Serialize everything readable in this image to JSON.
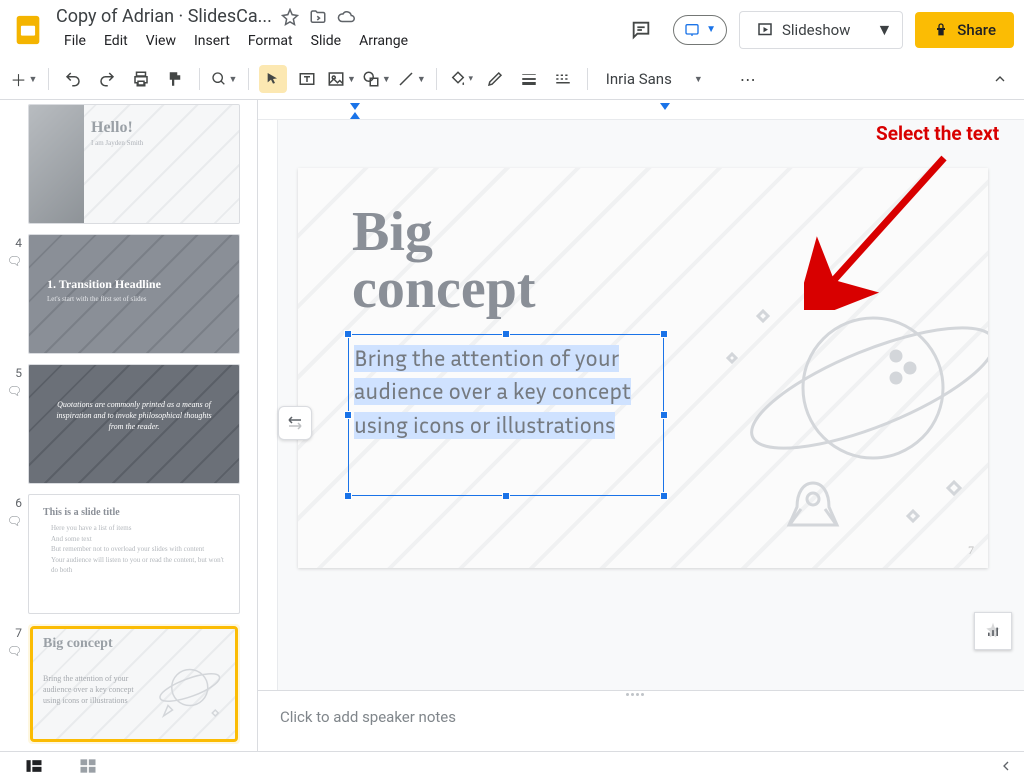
{
  "doc": {
    "title": "Copy of Adrian · SlidesCa..."
  },
  "menus": [
    "File",
    "Edit",
    "View",
    "Insert",
    "Format",
    "Slide",
    "Arrange"
  ],
  "header": {
    "slideshow": "Slideshow",
    "share": "Share"
  },
  "toolbar": {
    "font": "Inria Sans"
  },
  "thumbs": [
    {
      "num": "",
      "title": "Hello!",
      "sub": "I am Jayden Smith",
      "variant": "light-photo"
    },
    {
      "num": "4",
      "title": "1. Transition Headline",
      "sub": "Let's start with the first set of slides",
      "variant": "mid"
    },
    {
      "num": "5",
      "title": "Quotations are commonly printed as a means of inspiration and to invoke philosophical thoughts from the reader.",
      "sub": "",
      "variant": "dark"
    },
    {
      "num": "6",
      "title": "This is a slide title",
      "sub": "Here you have a list of items\nAnd some text\nBut remember not to overload your slides with content\nYour audience will listen to you or read the content, but won't do both",
      "variant": "white"
    },
    {
      "num": "7",
      "title": "Big concept",
      "sub": "Bring the attention of your audience over a key concept using icons or illustrations",
      "variant": "light",
      "selected": true
    }
  ],
  "slide": {
    "title_line1": "Big",
    "title_line2": "concept",
    "body": "Bring the attention of your audience over a key concept using icons or illustrations",
    "page_number": "7"
  },
  "annotation": {
    "text": "Select the text"
  },
  "notes": {
    "placeholder": "Click to add speaker notes"
  }
}
